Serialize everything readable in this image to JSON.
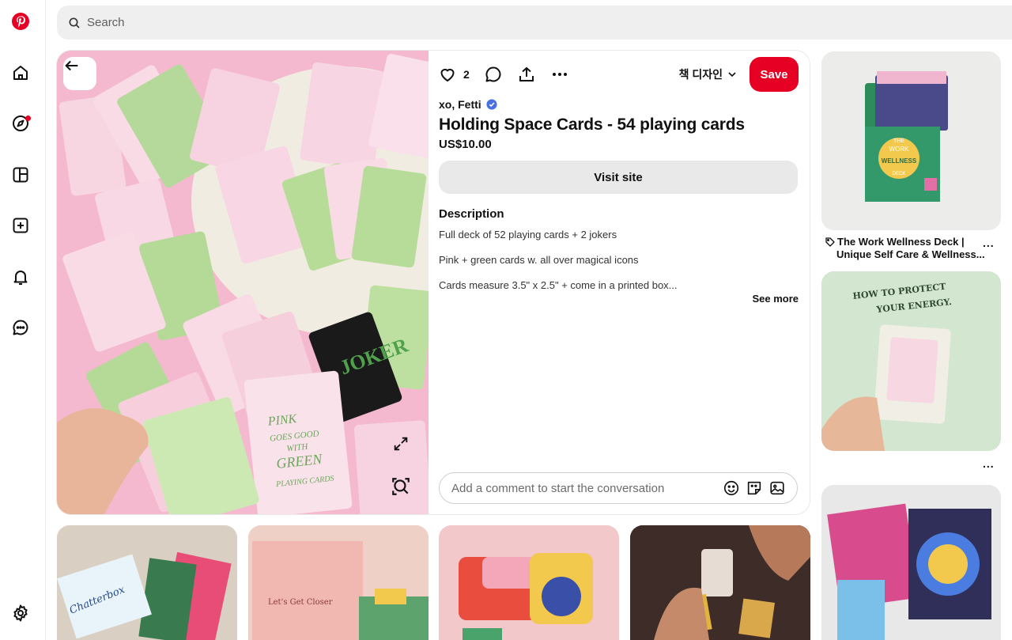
{
  "search": {
    "placeholder": "Search"
  },
  "nav": {
    "items": [
      "pinterest-logo",
      "home",
      "explore",
      "boards",
      "create",
      "notifications",
      "messages",
      "settings"
    ]
  },
  "pin": {
    "like_count": "2",
    "board_name": "책 디자인",
    "save_label": "Save",
    "creator": "xo, Fetti",
    "title": "Holding Space Cards - 54 playing cards",
    "price": "US$10.00",
    "visit_label": "Visit site",
    "description_heading": "Description",
    "description_lines": [
      "Full deck of 52 playing cards + 2 jokers",
      "Pink + green cards w. all over magical icons",
      "Cards measure 3.5\" x 2.5\" + come in a printed box..."
    ],
    "see_more": "See more",
    "comment_placeholder": "Add a comment to start the conversation"
  },
  "image_text": {
    "joker": "JOKER",
    "box": [
      "PINK",
      "GOES GOOD",
      "WITH",
      "GREEN",
      "PLAYING CARDS"
    ]
  },
  "related": {
    "side_pins": [
      {
        "title_line1": "The Work Wellness Deck |",
        "title_line2": "Unique Self Care & Wellness...",
        "more": "...",
        "image_text": [
          "THE",
          "WORK",
          "WELLNESS",
          "DECK"
        ]
      },
      {
        "more": "...",
        "image_text": [
          "HOW TO PROTECT",
          "YOUR ENERGY."
        ]
      },
      {}
    ],
    "bottom_pins": [
      {
        "image_text": "Chatterbox"
      },
      {
        "image_text": "Let's Get Closer"
      },
      {},
      {}
    ]
  },
  "colors": {
    "brand_red": "#e60023",
    "search_bg": "#efefef",
    "visit_bg": "#e9e9e9",
    "card_pink": "#f7d3e1",
    "card_green": "#b8df9a"
  }
}
